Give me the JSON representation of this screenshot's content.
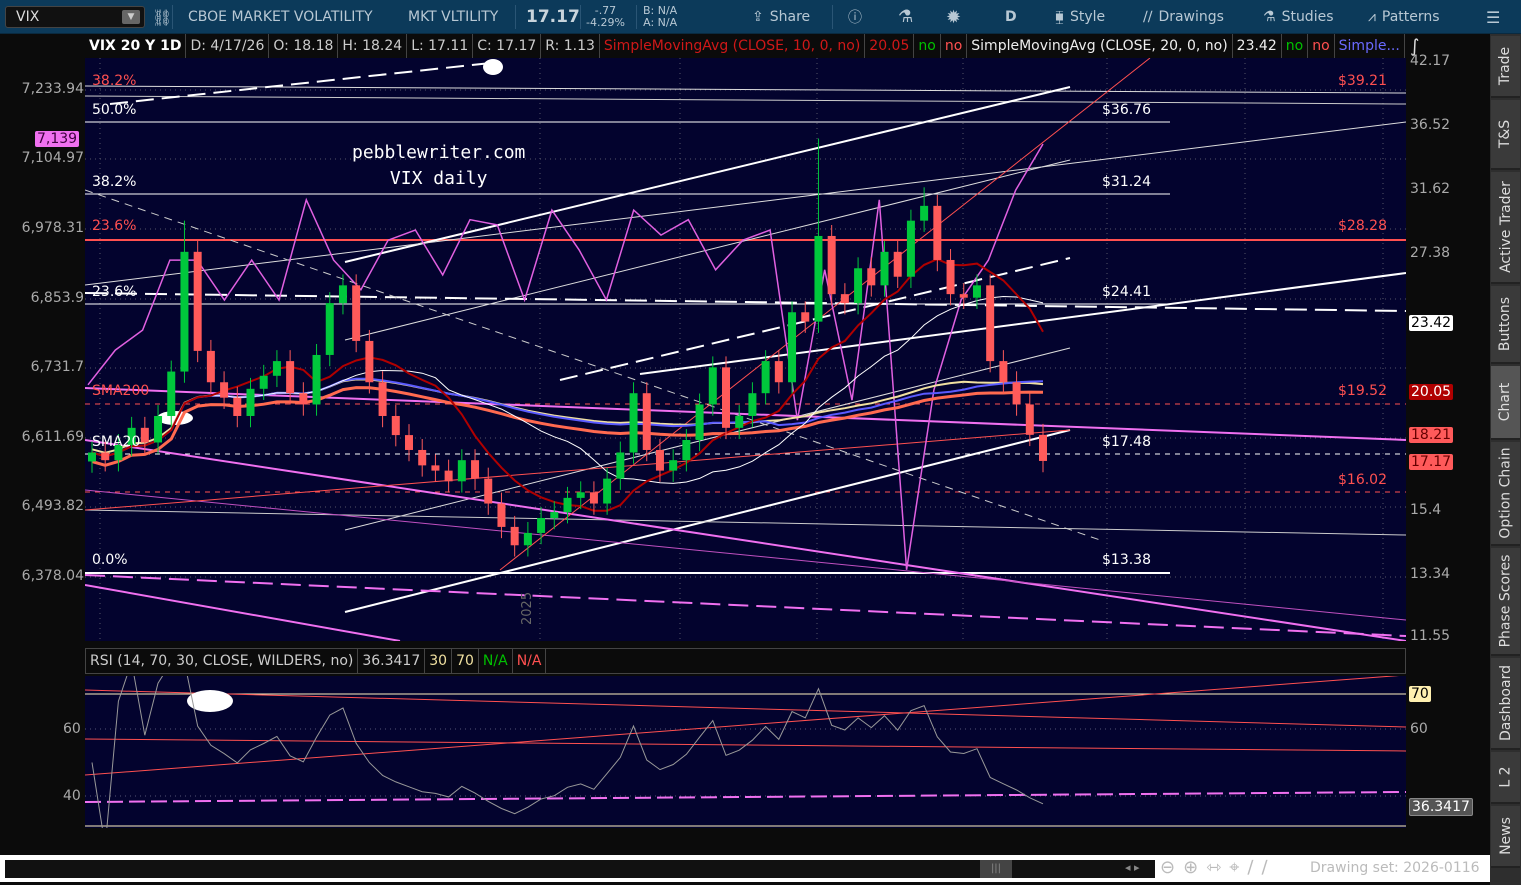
{
  "toolbar": {
    "symbol": "VIX",
    "description": "CBOE MARKET VOLATILITY",
    "exchange": "MKT VLTILITY",
    "last": "17.17",
    "change": "-.77",
    "change_pct": "-4.29%",
    "bid": "B: N/A",
    "ask": "A: N/A",
    "share": "Share",
    "style": "Style",
    "drawings": "Drawings",
    "studies": "Studies",
    "patterns": "Patterns",
    "aggregation": "D"
  },
  "legend": {
    "title": "VIX 20 Y 1D",
    "date": "D: 4/17/26",
    "open": "O: 18.18",
    "high": "H: 18.24",
    "low": "L: 17.11",
    "close": "C: 17.17",
    "range": "R: 1.13",
    "sma10": "SimpleMovingAvg (CLOSE, 10, 0, no)",
    "sma10_val": "20.05",
    "sma20": "SimpleMovingAvg (CLOSE, 20, 0, no)",
    "sma20_val": "23.42",
    "no": "no",
    "more": "Simple..."
  },
  "annotation": {
    "line1": "pebblewriter.com",
    "line2": "VIX daily"
  },
  "year_label": "2025",
  "fib_left": [
    {
      "t": "38.2%",
      "c": "#ff5050"
    },
    {
      "t": "50.0%",
      "c": "#fff"
    },
    {
      "t": "38.2%",
      "c": "#fff"
    },
    {
      "t": "23.6%",
      "c": "#ff5050"
    },
    {
      "t": "23.6%",
      "c": "#fff"
    },
    {
      "t": "SMA200",
      "c": "#ff5050"
    },
    {
      "t": "SMA20",
      "c": "#fff"
    },
    {
      "t": "0.0%",
      "c": "#fff"
    }
  ],
  "fib_right": [
    {
      "t": "$39.21",
      "c": "#ff5050"
    },
    {
      "t": "$36.76",
      "c": "#fff"
    },
    {
      "t": "$31.24",
      "c": "#fff"
    },
    {
      "t": "$28.28",
      "c": "#ff5050"
    },
    {
      "t": "$24.41",
      "c": "#fff"
    },
    {
      "t": "$19.52",
      "c": "#ff5050"
    },
    {
      "t": "$17.48",
      "c": "#fff"
    },
    {
      "t": "$16.02",
      "c": "#ff5050"
    },
    {
      "t": "$13.38",
      "c": "#fff"
    }
  ],
  "left_axis": [
    "7,233.94",
    "7,104.97",
    "6,978.31",
    "6,853.9",
    "6,731.7",
    "6,611.69",
    "6,493.82",
    "6,378.04"
  ],
  "left_badge": "7,139",
  "right_axis": [
    "42.17",
    "36.52",
    "31.62",
    "27.38",
    "15.4",
    "13.34",
    "11.55"
  ],
  "right_badges": [
    {
      "t": "23.42",
      "bg": "#ffffff",
      "fg": "#000"
    },
    {
      "t": "20.05",
      "bg": "#b00000",
      "fg": "#fff"
    },
    {
      "t": "18.21",
      "bg": "#ff5a5a",
      "fg": "#600"
    },
    {
      "t": "17.17",
      "bg": "#ff5a5a",
      "fg": "#600"
    }
  ],
  "rsi": {
    "title": "RSI (14, 70, 30, CLOSE, WILDERS, no)",
    "value": "36.3417",
    "ob": "30",
    "os": "70",
    "na1": "N/A",
    "na2": "N/A",
    "axis": [
      "70",
      "60",
      "40"
    ],
    "badge": "36.3417"
  },
  "tabs": [
    "Trade",
    "T&S",
    "Active Trader",
    "Buttons",
    "Chart",
    "Option Chain",
    "Phase Scores",
    "Dashboard",
    "L 2",
    "News"
  ],
  "bottom": {
    "drawing_set": "Drawing set: 2026-0116"
  },
  "colors": {
    "up": "#00c83c",
    "down": "#ff5a5a",
    "sma10": "#b00000",
    "sma20": "#ffffff",
    "sma50": "#5a5aff",
    "sma200": "#ff6a50",
    "spx": "#e060e0",
    "bg": "#03032e"
  },
  "chart_data": {
    "type": "candlestick",
    "symbol": "VIX",
    "closes": [
      17.5,
      17.2,
      17.8,
      18.5,
      17.9,
      19.0,
      21.0,
      27.5,
      22.0,
      20.5,
      19.8,
      19.0,
      20.2,
      20.8,
      21.5,
      20.0,
      19.5,
      21.8,
      24.5,
      25.5,
      22.5,
      20.5,
      19.0,
      18.2,
      17.6,
      17.0,
      16.8,
      16.4,
      17.2,
      16.5,
      15.6,
      14.8,
      14.2,
      14.6,
      15.1,
      15.3,
      15.8,
      16.0,
      15.6,
      16.5,
      17.5,
      20.0,
      17.6,
      16.8,
      17.2,
      18.0,
      19.5,
      21.2,
      18.5,
      19.0,
      20.0,
      21.5,
      20.5,
      24.0,
      23.5,
      28.5,
      25.0,
      24.5,
      26.5,
      25.5,
      27.5,
      26.0,
      29.5,
      30.5,
      27.0,
      25.0,
      24.8,
      25.5,
      21.5,
      20.5,
      19.5,
      18.21,
      17.17
    ],
    "spike_highs": {
      "7": 29.5,
      "55": 35.5,
      "63": 31.8
    },
    "spx_overlay": [
      6716,
      6777,
      6812,
      6935,
      6935,
      6865,
      6935,
      6865,
      7041,
      6935,
      6883,
      6970,
      6988,
      6909,
      7006,
      6997,
      6865,
      7023,
      6953,
      6865,
      7023,
      6979,
      7006,
      6918,
      6970,
      6988,
      6654,
      6918,
      6689,
      7041,
      6391,
      6707,
      6865,
      6935,
      7058,
      7139
    ],
    "y_range": [
      11.55,
      42.17
    ],
    "scale": "log"
  }
}
